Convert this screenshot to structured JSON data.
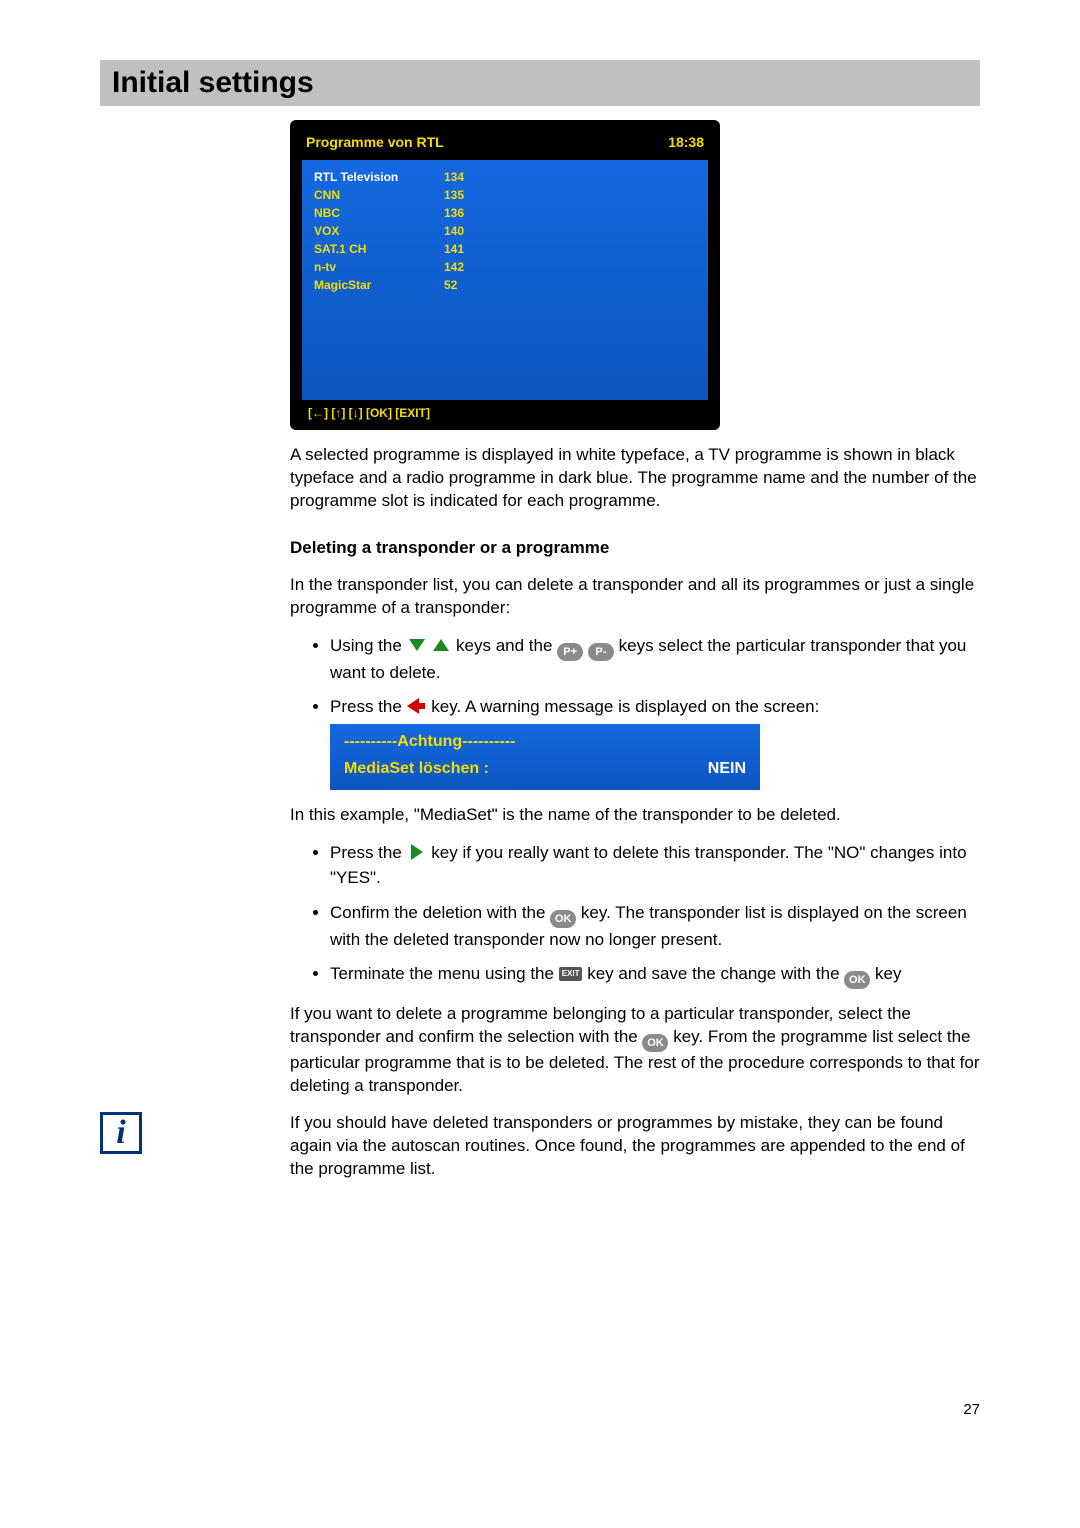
{
  "page_title": "Initial settings",
  "tv": {
    "header_title": "Programme von RTL",
    "header_time": "18:38",
    "rows": [
      {
        "name": "RTL Television",
        "num": "134",
        "selected": true
      },
      {
        "name": "CNN",
        "num": "135",
        "selected": false
      },
      {
        "name": "NBC",
        "num": "136",
        "selected": false
      },
      {
        "name": "VOX",
        "num": "140",
        "selected": false
      },
      {
        "name": "SAT.1 CH",
        "num": "141",
        "selected": false
      },
      {
        "name": "n-tv",
        "num": "142",
        "selected": false
      },
      {
        "name": "MagicStar",
        "num": "52",
        "selected": false
      }
    ],
    "footer": "[←] [↑] [↓] [OK] [EXIT]"
  },
  "para1": "A selected programme is displayed in white typeface, a TV programme is shown in black typeface and a radio programme in dark blue. The programme name and the number of the programme slot is indicated for each programme.",
  "heading2": "Deleting a transponder or a programme",
  "para2": "In the transponder list, you can delete a transponder and all its programmes or just a single programme of a transponder:",
  "b1a": "Using the ",
  "b1b": " keys and the ",
  "b1c": " keys select the particular transponder that you want to delete.",
  "b2a": "Press the ",
  "b2b": " key. A warning message is displayed on the screen:",
  "warning": {
    "title": "----------Achtung----------",
    "label": "MediaSet löschen :",
    "value": "NEIN"
  },
  "para3": "In this example, \"MediaSet\" is the name of the transponder to be deleted.",
  "b3a": "Press the ",
  "b3b": " key if you really want to delete this transponder. The \"NO\" changes into \"YES\".",
  "b4a": "Confirm the deletion with the ",
  "b4b": " key. The transponder list is displayed on the screen with the deleted transponder now no longer present.",
  "b5a": "Terminate the menu using the ",
  "b5b": " key and save the change with the ",
  "b5c": " key",
  "para4a": "If you want to delete a programme belonging to a particular transponder, select the transponder and confirm the selection with the ",
  "para4b": " key. From the programme list select the particular programme that is to be deleted. The rest of the procedure corresponds to that for deleting a transponder.",
  "info_para": "If you should have deleted transponders or programmes by mistake, they can be found again via the autoscan routines. Once found, the programmes are appended to the end of the programme list.",
  "ok_label": "OK",
  "pplus": "P+",
  "pminus": "P-",
  "exit_label": "EXIT",
  "page_number": "27"
}
